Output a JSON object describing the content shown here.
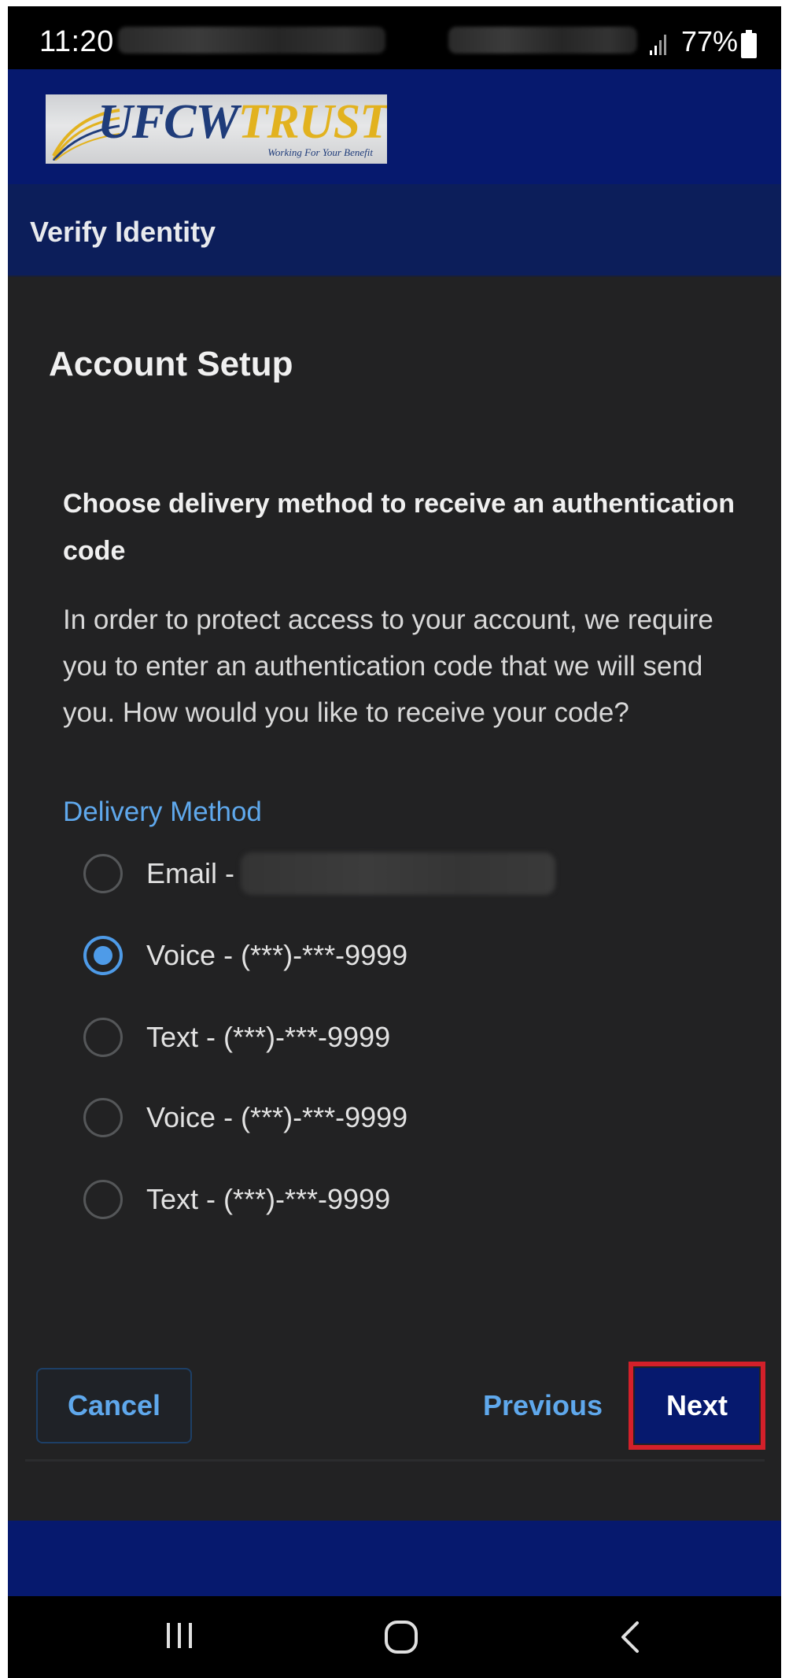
{
  "status_bar": {
    "time": "11:20",
    "battery": "77%",
    "icons": [
      "signal-icon",
      "battery-icon"
    ]
  },
  "header": {
    "logo_brand_part1": "UFCW",
    "logo_brand_part2": "TRUST",
    "logo_tagline": "Working For Your Benefit",
    "page_title": "Verify Identity"
  },
  "main": {
    "section_title": "Account Setup",
    "question": "Choose delivery method to receive an authentication code",
    "description": "In order to protect access to your account, we require you to enter an authentication code that we will send you. How would you like to receive your code?",
    "delivery_label": "Delivery Method",
    "options": [
      {
        "label": "Email -",
        "checked": false
      },
      {
        "label": "Voice - (***)-***-9999",
        "checked": true
      },
      {
        "label": "Text - (***)-***-9999",
        "checked": false
      },
      {
        "label": "Voice - (***)-***-9999",
        "checked": false
      },
      {
        "label": "Text - (***)-***-9999",
        "checked": false
      }
    ]
  },
  "actions": {
    "cancel_label": "Cancel",
    "previous_label": "Previous",
    "next_label": "Next"
  },
  "colors": {
    "brand_navy": "#06196e",
    "link_blue": "#5fa8ec",
    "radio_selected": "#4e9be8",
    "highlight_red": "#d3202a",
    "background": "#222223"
  },
  "nav_bar": {
    "icons": [
      "recent-apps-icon",
      "home-icon",
      "back-icon"
    ]
  }
}
